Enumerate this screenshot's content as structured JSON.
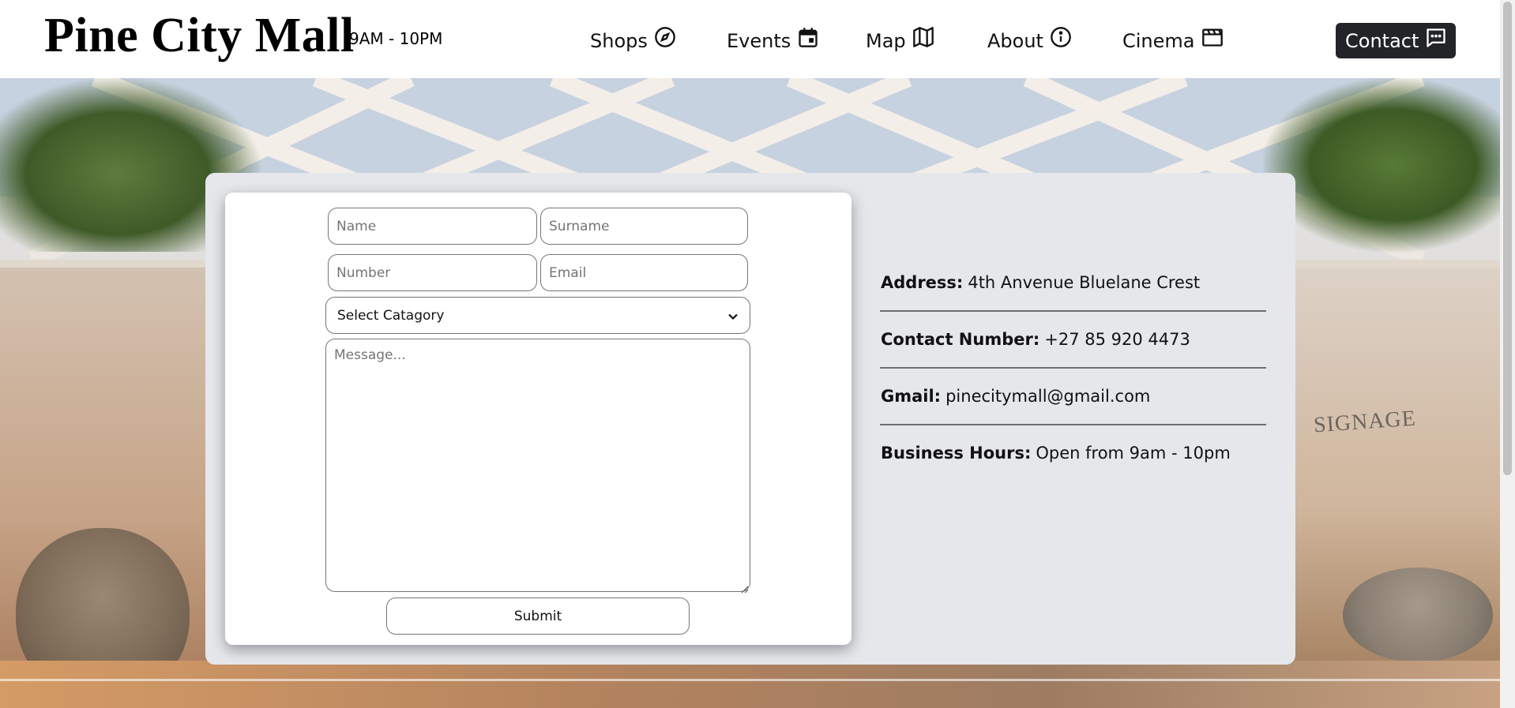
{
  "header": {
    "brand": "Pine City Mall",
    "hours": "9AM - 10PM",
    "nav": [
      {
        "label": "Shops",
        "icon": "compass-icon"
      },
      {
        "label": "Events",
        "icon": "calendar-icon"
      },
      {
        "label": "Map",
        "icon": "map-icon"
      },
      {
        "label": "About",
        "icon": "info-icon"
      },
      {
        "label": "Cinema",
        "icon": "clapperboard-icon"
      }
    ],
    "contact": {
      "label": "Contact",
      "icon": "message-icon"
    }
  },
  "hero": {
    "signage": "SIGNAGE"
  },
  "form": {
    "name_placeholder": "Name",
    "surname_placeholder": "Surname",
    "number_placeholder": "Number",
    "email_placeholder": "Email",
    "category_selected": "Select Catagory",
    "message_placeholder": "Message...",
    "submit_label": "Submit"
  },
  "info": {
    "address": {
      "key": "Address:",
      "value": "4th Anvenue Bluelane Crest"
    },
    "phone": {
      "key": "Contact Number:",
      "value": "+27 85 920 4473"
    },
    "gmail": {
      "key": "Gmail:",
      "value": "pinecitymall@gmail.com"
    },
    "hours": {
      "key": "Business Hours:",
      "value": "Open from 9am - 10pm"
    }
  },
  "colors": {
    "contact_button_bg": "#222428",
    "panel_bg": "#e5e7eb",
    "card_bg": "#ffffff",
    "text": "#111111"
  }
}
